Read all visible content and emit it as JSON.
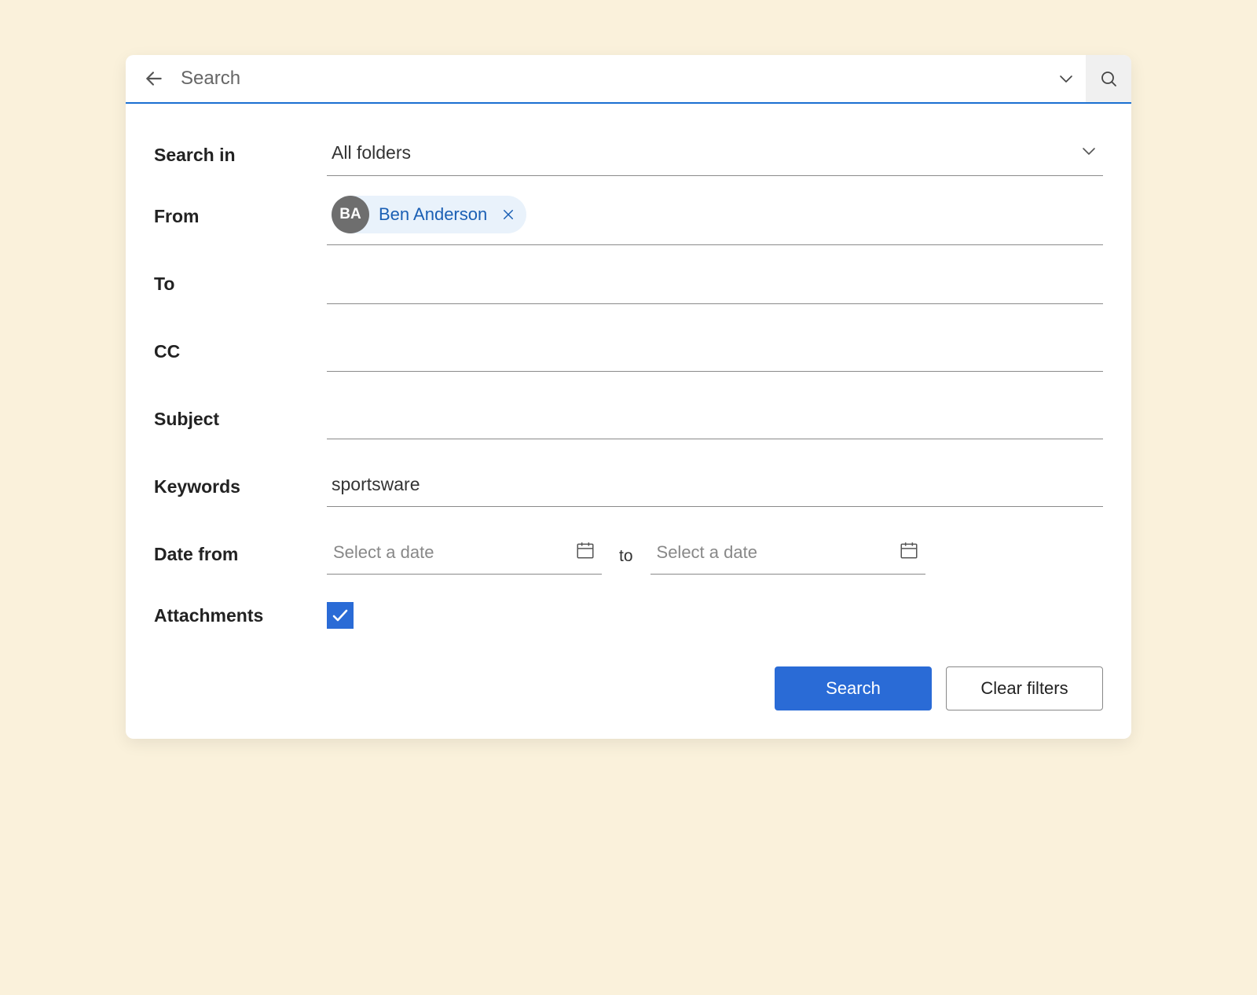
{
  "topbar": {
    "search_placeholder": "Search"
  },
  "labels": {
    "search_in": "Search in",
    "from": "From",
    "to": "To",
    "cc": "CC",
    "subject": "Subject",
    "keywords": "Keywords",
    "date_from": "Date from",
    "date_to_sep": "to",
    "attachments": "Attachments"
  },
  "fields": {
    "search_in_value": "All folders",
    "from_chip": {
      "initials": "BA",
      "name": "Ben Anderson"
    },
    "to_value": "",
    "cc_value": "",
    "subject_value": "",
    "keywords_value": "sportsware",
    "date_start_placeholder": "Select a date",
    "date_end_placeholder": "Select a date",
    "attachments_checked": true
  },
  "buttons": {
    "search": "Search",
    "clear": "Clear filters"
  }
}
